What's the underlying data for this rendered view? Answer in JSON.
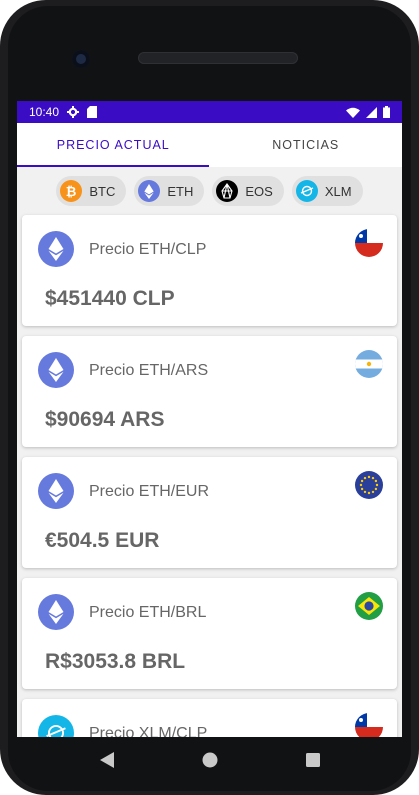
{
  "status": {
    "time": "10:40"
  },
  "tabs": [
    {
      "label": "PRECIO ACTUAL",
      "active": true
    },
    {
      "label": "NOTICIAS",
      "active": false
    }
  ],
  "chips": [
    {
      "label": "BTC",
      "icon": "bitcoin-icon",
      "color": "#f7931a"
    },
    {
      "label": "ETH",
      "icon": "ethereum-icon",
      "color": "#6679dd"
    },
    {
      "label": "EOS",
      "icon": "eos-icon",
      "color": "#000000"
    },
    {
      "label": "XLM",
      "icon": "stellar-icon",
      "color": "#14b6e7"
    }
  ],
  "cards": [
    {
      "title": "Precio ETH/CLP",
      "price": "$451440 CLP",
      "flag": "chile-flag-icon"
    },
    {
      "title": "Precio ETH/ARS",
      "price": "$90694 ARS",
      "flag": "argentina-flag-icon"
    },
    {
      "title": "Precio ETH/EUR",
      "price": "€504.5 EUR",
      "flag": "eu-flag-icon"
    },
    {
      "title": "Precio ETH/BRL",
      "price": "R$3053.8 BRL",
      "flag": "brazil-flag-icon"
    },
    {
      "title": "Precio XLM/CLP",
      "price": "",
      "flag": "chile-flag-icon"
    }
  ],
  "colors": {
    "accent": "#3a0cc4",
    "eth": "#6679dd",
    "xlm": "#14b6e7"
  }
}
